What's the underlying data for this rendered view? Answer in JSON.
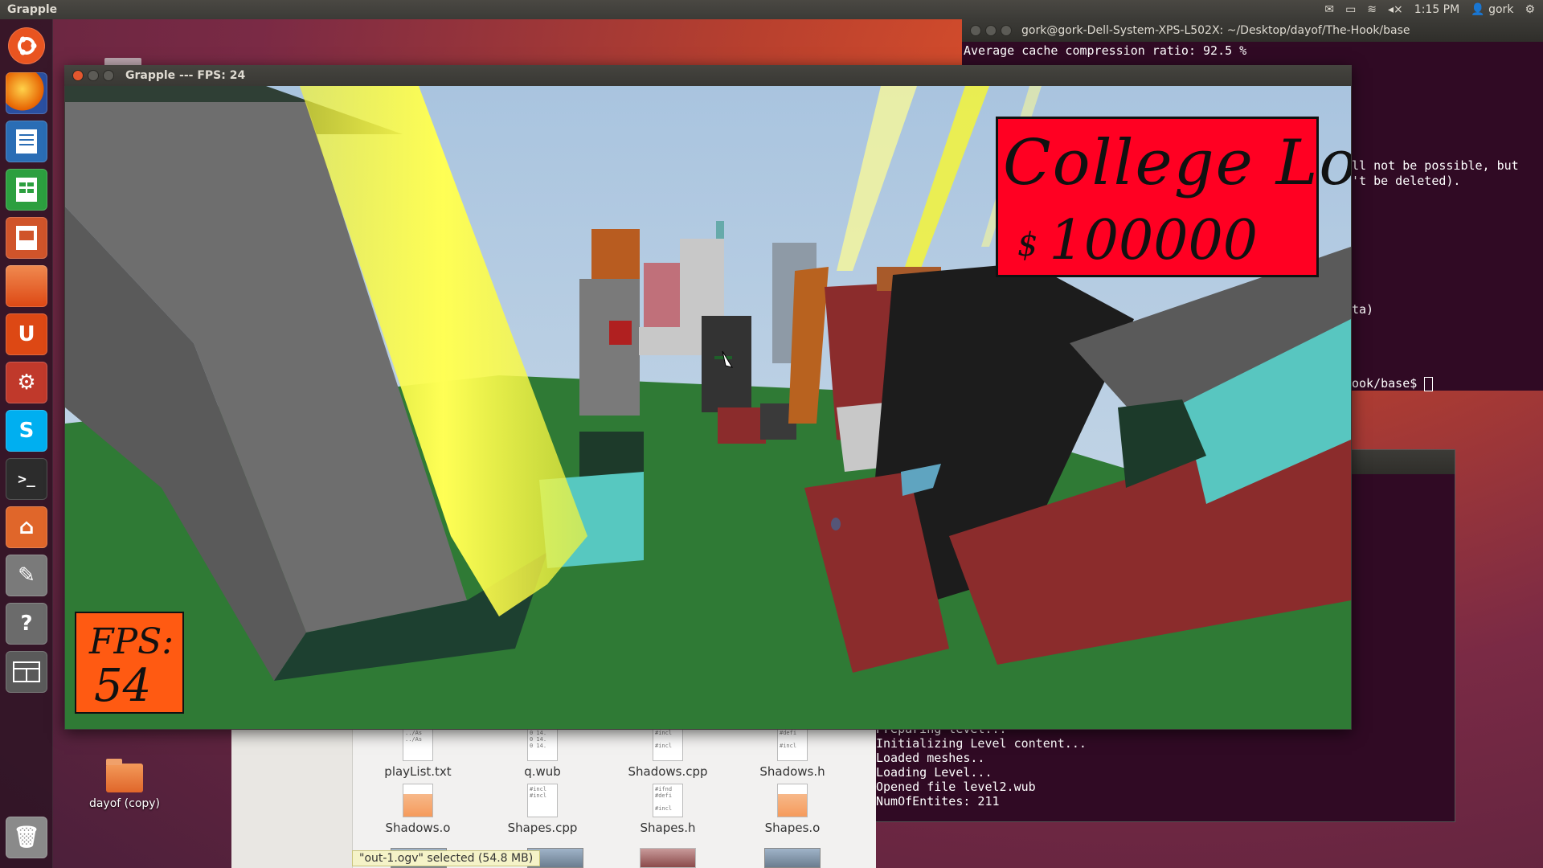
{
  "top_panel": {
    "app_title": "Grapple",
    "time": "1:15 PM",
    "user": "gork",
    "icons": [
      "mail-icon",
      "battery-icon",
      "wifi-icon",
      "volume-icon",
      "user-icon",
      "settings-gear-icon"
    ]
  },
  "launcher": {
    "items": [
      {
        "name": "ubuntu-dash",
        "icon": "ubuntu-logo-icon",
        "color": "#e95420"
      },
      {
        "name": "firefox",
        "icon": "firefox-icon",
        "color": "#e66000"
      },
      {
        "name": "libreoffice-writer",
        "icon": "writer-icon",
        "color": "#2a6db5"
      },
      {
        "name": "libreoffice-calc",
        "icon": "calc-icon",
        "color": "#2c9f3f"
      },
      {
        "name": "libreoffice-impress",
        "icon": "impress-icon",
        "color": "#d0542a"
      },
      {
        "name": "software-center",
        "icon": "shopping-bag-icon",
        "color": "#dd4814"
      },
      {
        "name": "ubuntu-one",
        "icon": "ubuntu-one-icon",
        "color": "#dd4814",
        "glyph": "U"
      },
      {
        "name": "system-settings",
        "icon": "gear-wrench-icon",
        "color": "#c0392b"
      },
      {
        "name": "skype",
        "icon": "skype-icon",
        "color": "#00aff0",
        "glyph": "S"
      },
      {
        "name": "terminal",
        "icon": "terminal-icon",
        "color": "#2c2c2c",
        "glyph": ">_"
      },
      {
        "name": "home-folder",
        "icon": "home-folder-icon",
        "color": "#e0662a"
      },
      {
        "name": "text-editor",
        "icon": "text-editor-icon",
        "color": "#7a7a7a"
      },
      {
        "name": "help",
        "icon": "help-icon",
        "color": "#6b6b6b",
        "glyph": "?"
      },
      {
        "name": "workspace-switcher",
        "icon": "workspaces-icon",
        "color": "#5a5a5a"
      },
      {
        "name": "trash",
        "icon": "trash-icon",
        "color": "#8a8a8a"
      }
    ]
  },
  "terminal_top": {
    "title": "gork@gork-Dell-System-XPS-L502X: ~/Desktop/dayof/The-Hook/base",
    "lines": [
      "Average cache compression ratio: 92.5 %",
      "ll not be possible, but",
      "'t be deleted).",
      "ta)",
      "ook/base$ "
    ]
  },
  "terminal_bottom": {
    "lines": [
      "Preparing level...",
      "Initializing Level content...",
      "Loaded meshes..",
      "Loading Level...",
      "Opened file level2.wub",
      "NumOfEntites: 211"
    ]
  },
  "file_manager": {
    "files": [
      {
        "name": "playList.txt",
        "kind": "text",
        "preview": "../As\n../As"
      },
      {
        "name": "q.wub",
        "kind": "text",
        "preview": "0 14.\n0 14.\n0 14."
      },
      {
        "name": "Shadows.cpp",
        "kind": "text",
        "preview": "#incl\n\n#incl"
      },
      {
        "name": "Shadows.h",
        "kind": "text",
        "preview": "#defi\n\n#incl"
      },
      {
        "name": "Shadows.o",
        "kind": "object",
        "preview": ""
      },
      {
        "name": "Shapes.cpp",
        "kind": "text",
        "preview": "#incl\n#incl"
      },
      {
        "name": "Shapes.h",
        "kind": "text",
        "preview": "#ifnd\n#defi\n\n#incl"
      },
      {
        "name": "Shapes.o",
        "kind": "object",
        "preview": ""
      }
    ],
    "status": "\"out-1.ogv\" selected (54.8 MB)"
  },
  "desktop": {
    "folder_label": "dayof (copy)"
  },
  "game_window": {
    "title": "Grapple --- FPS: 24",
    "loan_title": "College Loan",
    "loan_currency": "$",
    "loan_amount": "100000",
    "fps_label": "FPS:",
    "fps_value": "54",
    "colors": {
      "loan_bg": "#ff0022",
      "fps_bg": "#ff5a12",
      "ground": "#2f7a35",
      "sky": "#b8d0e6",
      "beam": "#f7f73a"
    }
  }
}
